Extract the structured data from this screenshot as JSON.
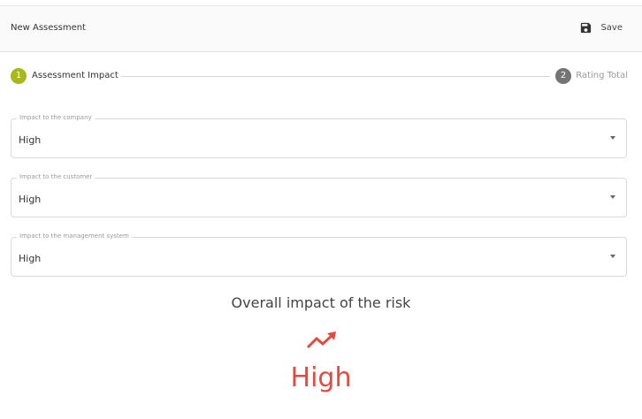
{
  "header": {
    "title": "New Assessment",
    "save_label": "Save",
    "save_icon": "save-icon"
  },
  "stepper": {
    "steps": [
      {
        "number": "1",
        "label": "Assessment Impact",
        "active": true
      },
      {
        "number": "2",
        "label": "Rating Total",
        "active": false
      }
    ]
  },
  "form": {
    "fields": [
      {
        "label": "Impact to the company",
        "value": "High"
      },
      {
        "label": "Impact to the customer",
        "value": "High"
      },
      {
        "label": "Impact to the management system",
        "value": "High"
      }
    ]
  },
  "summary": {
    "label": "Overall impact of the risk",
    "value": "High",
    "icon": "trending-up-icon"
  },
  "colors": {
    "step_active": "#a7b81a",
    "step_inactive": "#757575",
    "risk_high": "#e64a3e"
  }
}
